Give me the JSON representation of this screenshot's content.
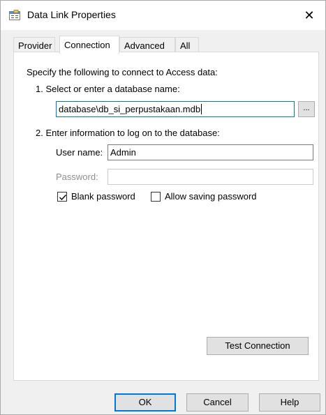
{
  "window": {
    "title": "Data Link Properties",
    "close_glyph": "✕"
  },
  "tabs": [
    {
      "label": "Provider",
      "active": false
    },
    {
      "label": "Connection",
      "active": true
    },
    {
      "label": "Advanced",
      "active": false
    },
    {
      "label": "All",
      "active": false
    }
  ],
  "connection": {
    "intro": "Specify the following to connect to Access data:",
    "step1_label": "1. Select or enter a database name:",
    "database_value": "database\\db_si_perpustakaan.mdb",
    "browse_label": "...",
    "step2_label": "2. Enter information to log on to the database:",
    "username_label": "User name:",
    "username_value": "Admin",
    "password_label": "Password:",
    "password_value": "",
    "blank_password_label": "Blank password",
    "blank_password_checked": true,
    "allow_saving_label": "Allow saving password",
    "allow_saving_checked": false,
    "test_connection_label": "Test Connection"
  },
  "footer": {
    "ok_label": "OK",
    "cancel_label": "Cancel",
    "help_label": "Help"
  },
  "colors": {
    "focus_border": "#0078d7",
    "panel_bg": "#ffffff",
    "window_bg": "#f0f0f0",
    "disabled_text": "#8f8f8f"
  },
  "icons": {
    "title": "data-link-icon",
    "close": "close-icon",
    "check": "checkmark-icon"
  }
}
